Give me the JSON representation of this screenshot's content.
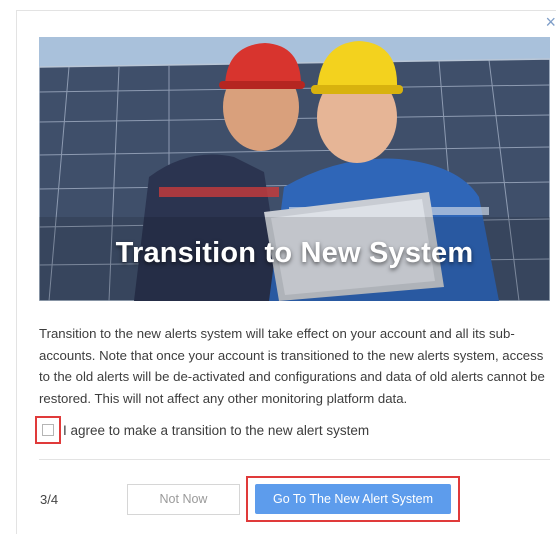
{
  "dialog": {
    "close_icon": "close-icon",
    "hero": {
      "image_subject": "two engineers in hard hats with a laptop in front of solar panels",
      "title": "Transition to New System"
    },
    "description": "Transition to the new alerts system will take effect on your account and all its sub-accounts. Note that once your account is transitioned to the new alerts system, access to the old alerts will be de-activated and configurations and data of old alerts cannot be restored.  This will not affect any other monitoring platform data.",
    "agree": {
      "checked": false,
      "label": "I agree to make a transition to the new alert system"
    },
    "footer": {
      "step": "3/4",
      "secondary_label": "Not Now",
      "primary_label": "Go To The New Alert System"
    }
  },
  "colors": {
    "primary": "#5d9cec",
    "highlight": "#e03a3a",
    "close": "#7f9ec8"
  }
}
